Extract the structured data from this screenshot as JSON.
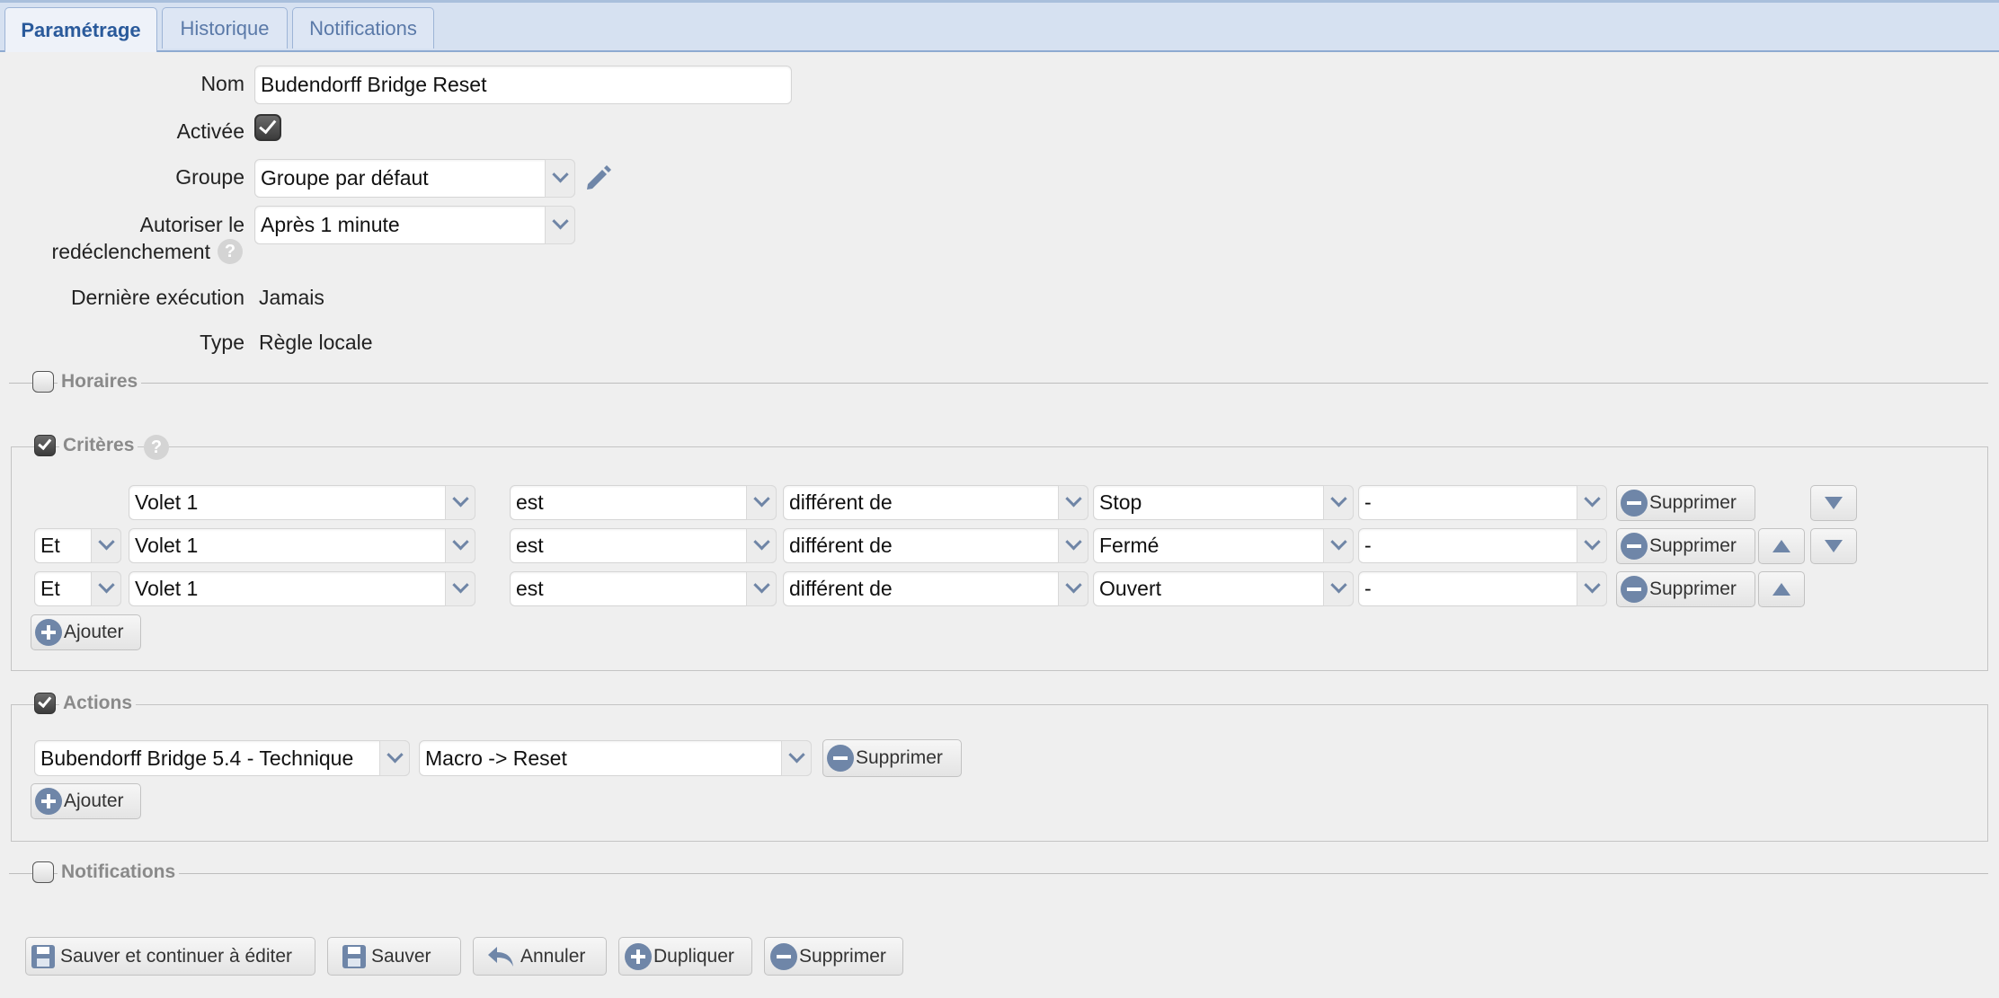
{
  "tabs": [
    {
      "label": "Paramétrage",
      "active": true
    },
    {
      "label": "Historique",
      "active": false
    },
    {
      "label": "Notifications",
      "active": false
    }
  ],
  "form": {
    "nom_label": "Nom",
    "nom_value": "Budendorff Bridge Reset",
    "activee_label": "Activée",
    "activee_checked": true,
    "groupe_label": "Groupe",
    "groupe_value": "Groupe par défaut",
    "redecl_label_1": "Autoriser le",
    "redecl_label_2": "redéclenchement",
    "redecl_value": "Après 1 minute",
    "derniere_label": "Dernière exécution",
    "derniere_value": "Jamais",
    "type_label": "Type",
    "type_value": "Règle locale"
  },
  "sections": {
    "horaires": {
      "label": "Horaires",
      "checked": false
    },
    "criteres": {
      "label": "Critères",
      "checked": true
    },
    "actions": {
      "label": "Actions",
      "checked": true
    },
    "notifications": {
      "label": "Notifications",
      "checked": false
    }
  },
  "criteria": [
    {
      "connector": "",
      "device": "Volet 1",
      "verb": "est",
      "op": "différent de",
      "value": "Stop",
      "extra": "-"
    },
    {
      "connector": "Et",
      "device": "Volet 1",
      "verb": "est",
      "op": "différent de",
      "value": "Fermé",
      "extra": "-"
    },
    {
      "connector": "Et",
      "device": "Volet 1",
      "verb": "est",
      "op": "différent de",
      "value": "Ouvert",
      "extra": "-"
    }
  ],
  "action_row": {
    "device": "Bubendorff Bridge 5.4 - Technique",
    "command": "Macro -> Reset"
  },
  "buttons": {
    "supprimer": "Supprimer",
    "ajouter": "Ajouter",
    "save_continue": "Sauver et continuer à éditer",
    "save": "Sauver",
    "cancel": "Annuler",
    "duplicate": "Dupliquer",
    "delete": "Supprimer"
  },
  "help_glyph": "?",
  "colors": {
    "tab_bar": "#d6e1f1",
    "accent": "#2a5a9b",
    "icon": "#6f86a8",
    "background": "#efefef"
  }
}
